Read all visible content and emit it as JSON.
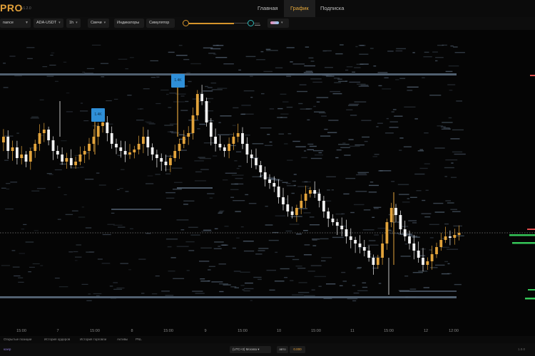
{
  "app": {
    "logo": "PRO",
    "version": "v1.2.0"
  },
  "nav": {
    "home": "Главная",
    "chart": "График",
    "subscription": "Подписка"
  },
  "toolbar": {
    "exchange": "nance",
    "pair": "ADA-USDT",
    "interval": "1h",
    "chart_type": "Свечи",
    "indicators": "Индикаторы",
    "simulator": "Симулятор",
    "slider_value_fraction": 0.63
  },
  "chart": {
    "tags": [
      "1.4K",
      "1.4K"
    ],
    "x_labels": [
      "15:00",
      "7",
      "15:00",
      "8",
      "15:00",
      "9",
      "15:00",
      "10",
      "15:00",
      "11",
      "15:00",
      "12",
      "12:00"
    ],
    "colors": {
      "up": "#e2a33b",
      "down": "#f2f2f2",
      "level": "#5a6a7c",
      "order_green": "#35c759",
      "order_red": "#e24d4d",
      "tag": "#2f8fd8"
    }
  },
  "bottom": {
    "tab1": "Открытые позиции",
    "tab2": "История ордеров",
    "tab3": "История торговли",
    "tab4": "Активы",
    "tab5": "PNL"
  },
  "footer": {
    "user": "юзер",
    "timezone": "(UTC+3) Москва",
    "auto_label": "авто",
    "auto_value": "0.000",
    "right_text": "1.0.0"
  }
}
